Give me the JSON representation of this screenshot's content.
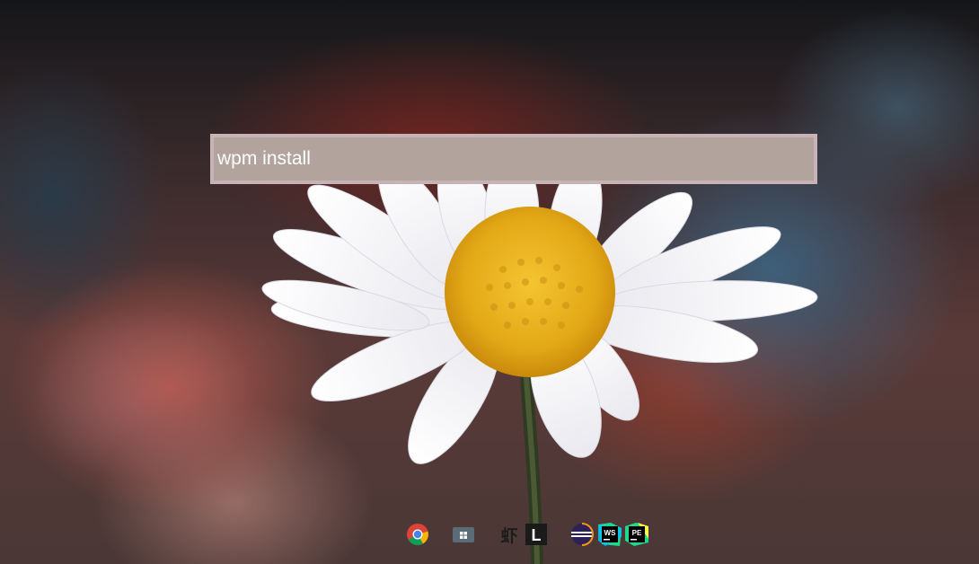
{
  "launcher": {
    "query": "wpm install"
  },
  "dock": {
    "items": [
      {
        "icon": "chrome-icon"
      },
      {
        "icon": "window-switcher-icon"
      },
      {
        "icon": "shrimp-character-icon",
        "glyph": "虾"
      },
      {
        "icon": "libreoffice-icon",
        "glyph": "L"
      },
      {
        "icon": "eclipse-icon"
      },
      {
        "icon": "webstorm-icon",
        "glyph": "WS"
      },
      {
        "icon": "pycharm-edu-icon",
        "glyph": "PE"
      }
    ]
  }
}
